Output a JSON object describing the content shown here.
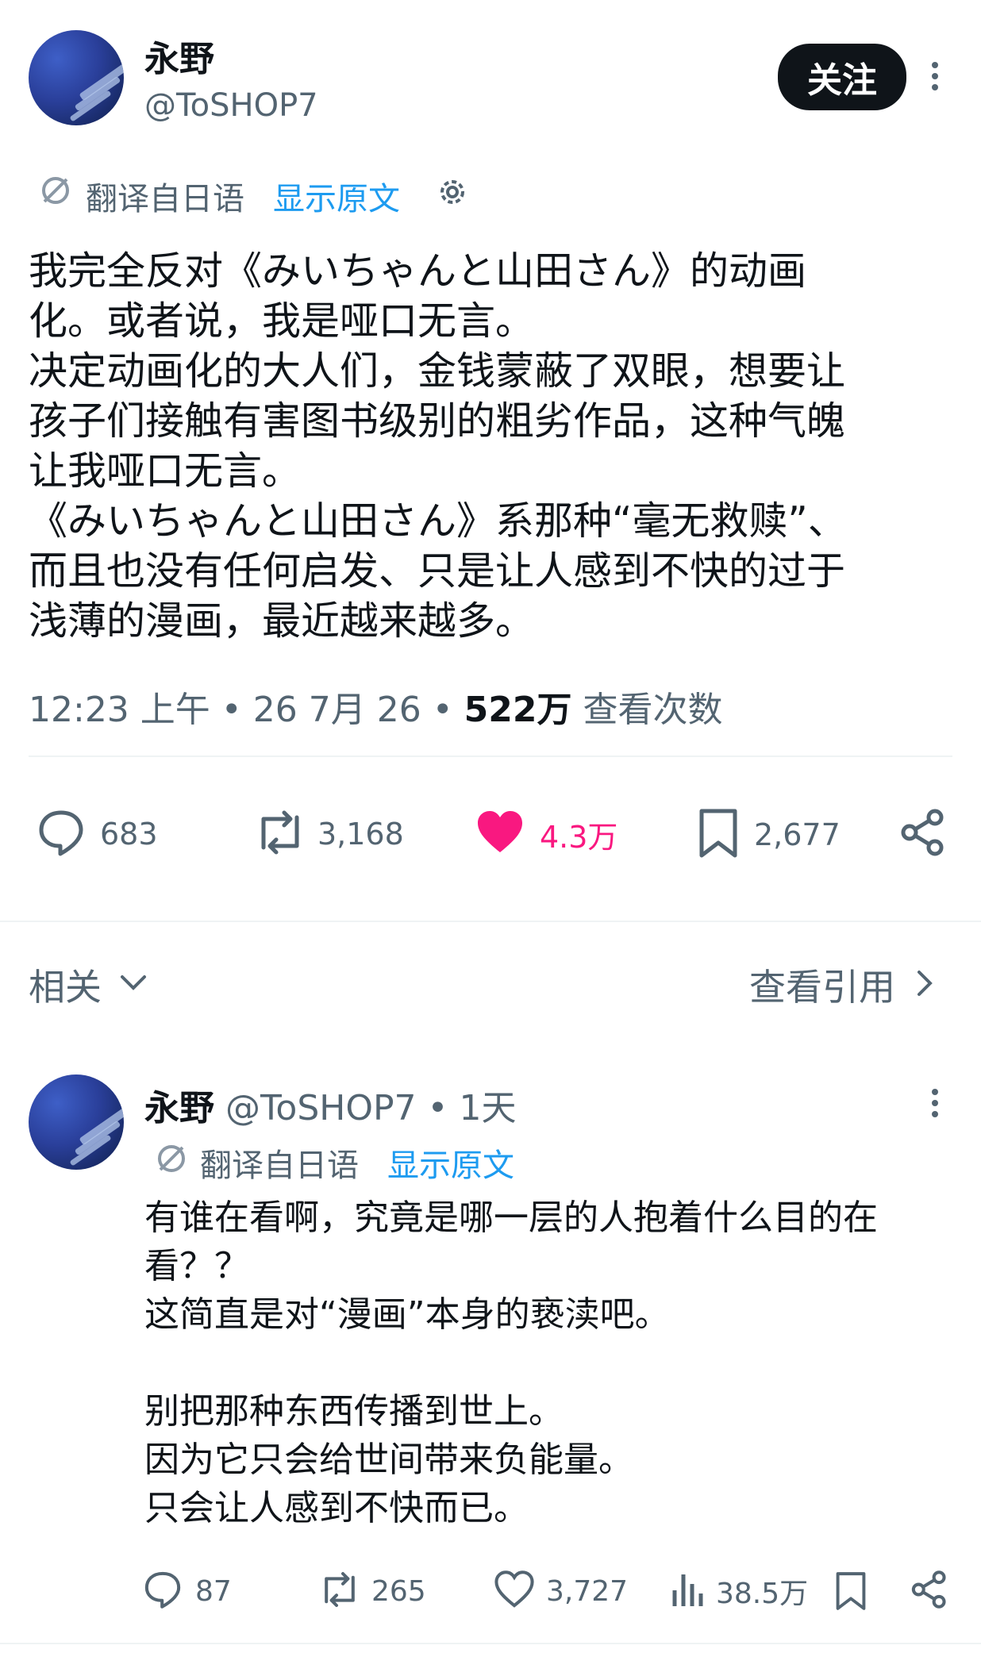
{
  "post": {
    "display_name": "永野",
    "handle": "@ToSHOP7",
    "follow_label": "关注",
    "translate_note": "翻译自日语",
    "show_original": "显示原文",
    "body_lines": [
      "我完全反对《みいちゃんと山田さん》的动画",
      "化。或者说，我是哑口无言。",
      "决定动画化的大人们，金钱蒙蔽了双眼，想要让",
      "孩子们接触有害图书级别的粗劣作品，这种气魄",
      "让我哑口无言。",
      "《みいちゃんと山田さん》系那种“毫无救赎”、",
      "而且也没有任何启发、只是让人感到不快的过于",
      "浅薄的漫画，最近越来越多。"
    ],
    "meta": {
      "time": "12:23 上午",
      "date": "26 7月 26",
      "views_count": "522万",
      "views_label": "查看次数"
    },
    "actions": {
      "replies": "683",
      "reposts": "3,168",
      "likes": "4.3万",
      "bookmarks": "2,677"
    }
  },
  "related": {
    "label": "相关",
    "view_quotes": "查看引用"
  },
  "reply": {
    "display_name": "永野",
    "handle": "@ToSHOP7",
    "time_ago": "1天",
    "translate_note": "翻译自日语",
    "show_original": "显示原文",
    "body_lines": [
      "有谁在看啊，究竟是哪一层的人抱着什么目的在",
      "看？？",
      "这简直是对“漫画”本身的亵渎吧。",
      "",
      "别把那种东西传播到世上。",
      "因为它只会给世间带来负能量。",
      "只会让人感到不快而已。"
    ],
    "actions": {
      "replies": "87",
      "reposts": "265",
      "likes": "3,727",
      "views": "38.5万"
    }
  },
  "colors": {
    "like_active": "#f91880",
    "link": "#1d9bf0",
    "secondary_text": "#536471",
    "primary_text": "#0f1419"
  },
  "icons": [
    "avatar",
    "more-icon",
    "translate-icon",
    "settings-gear-icon",
    "reply-icon",
    "repost-icon",
    "like-icon",
    "bookmark-icon",
    "share-icon",
    "chevron-down-icon",
    "chevron-right-icon",
    "views-icon"
  ]
}
